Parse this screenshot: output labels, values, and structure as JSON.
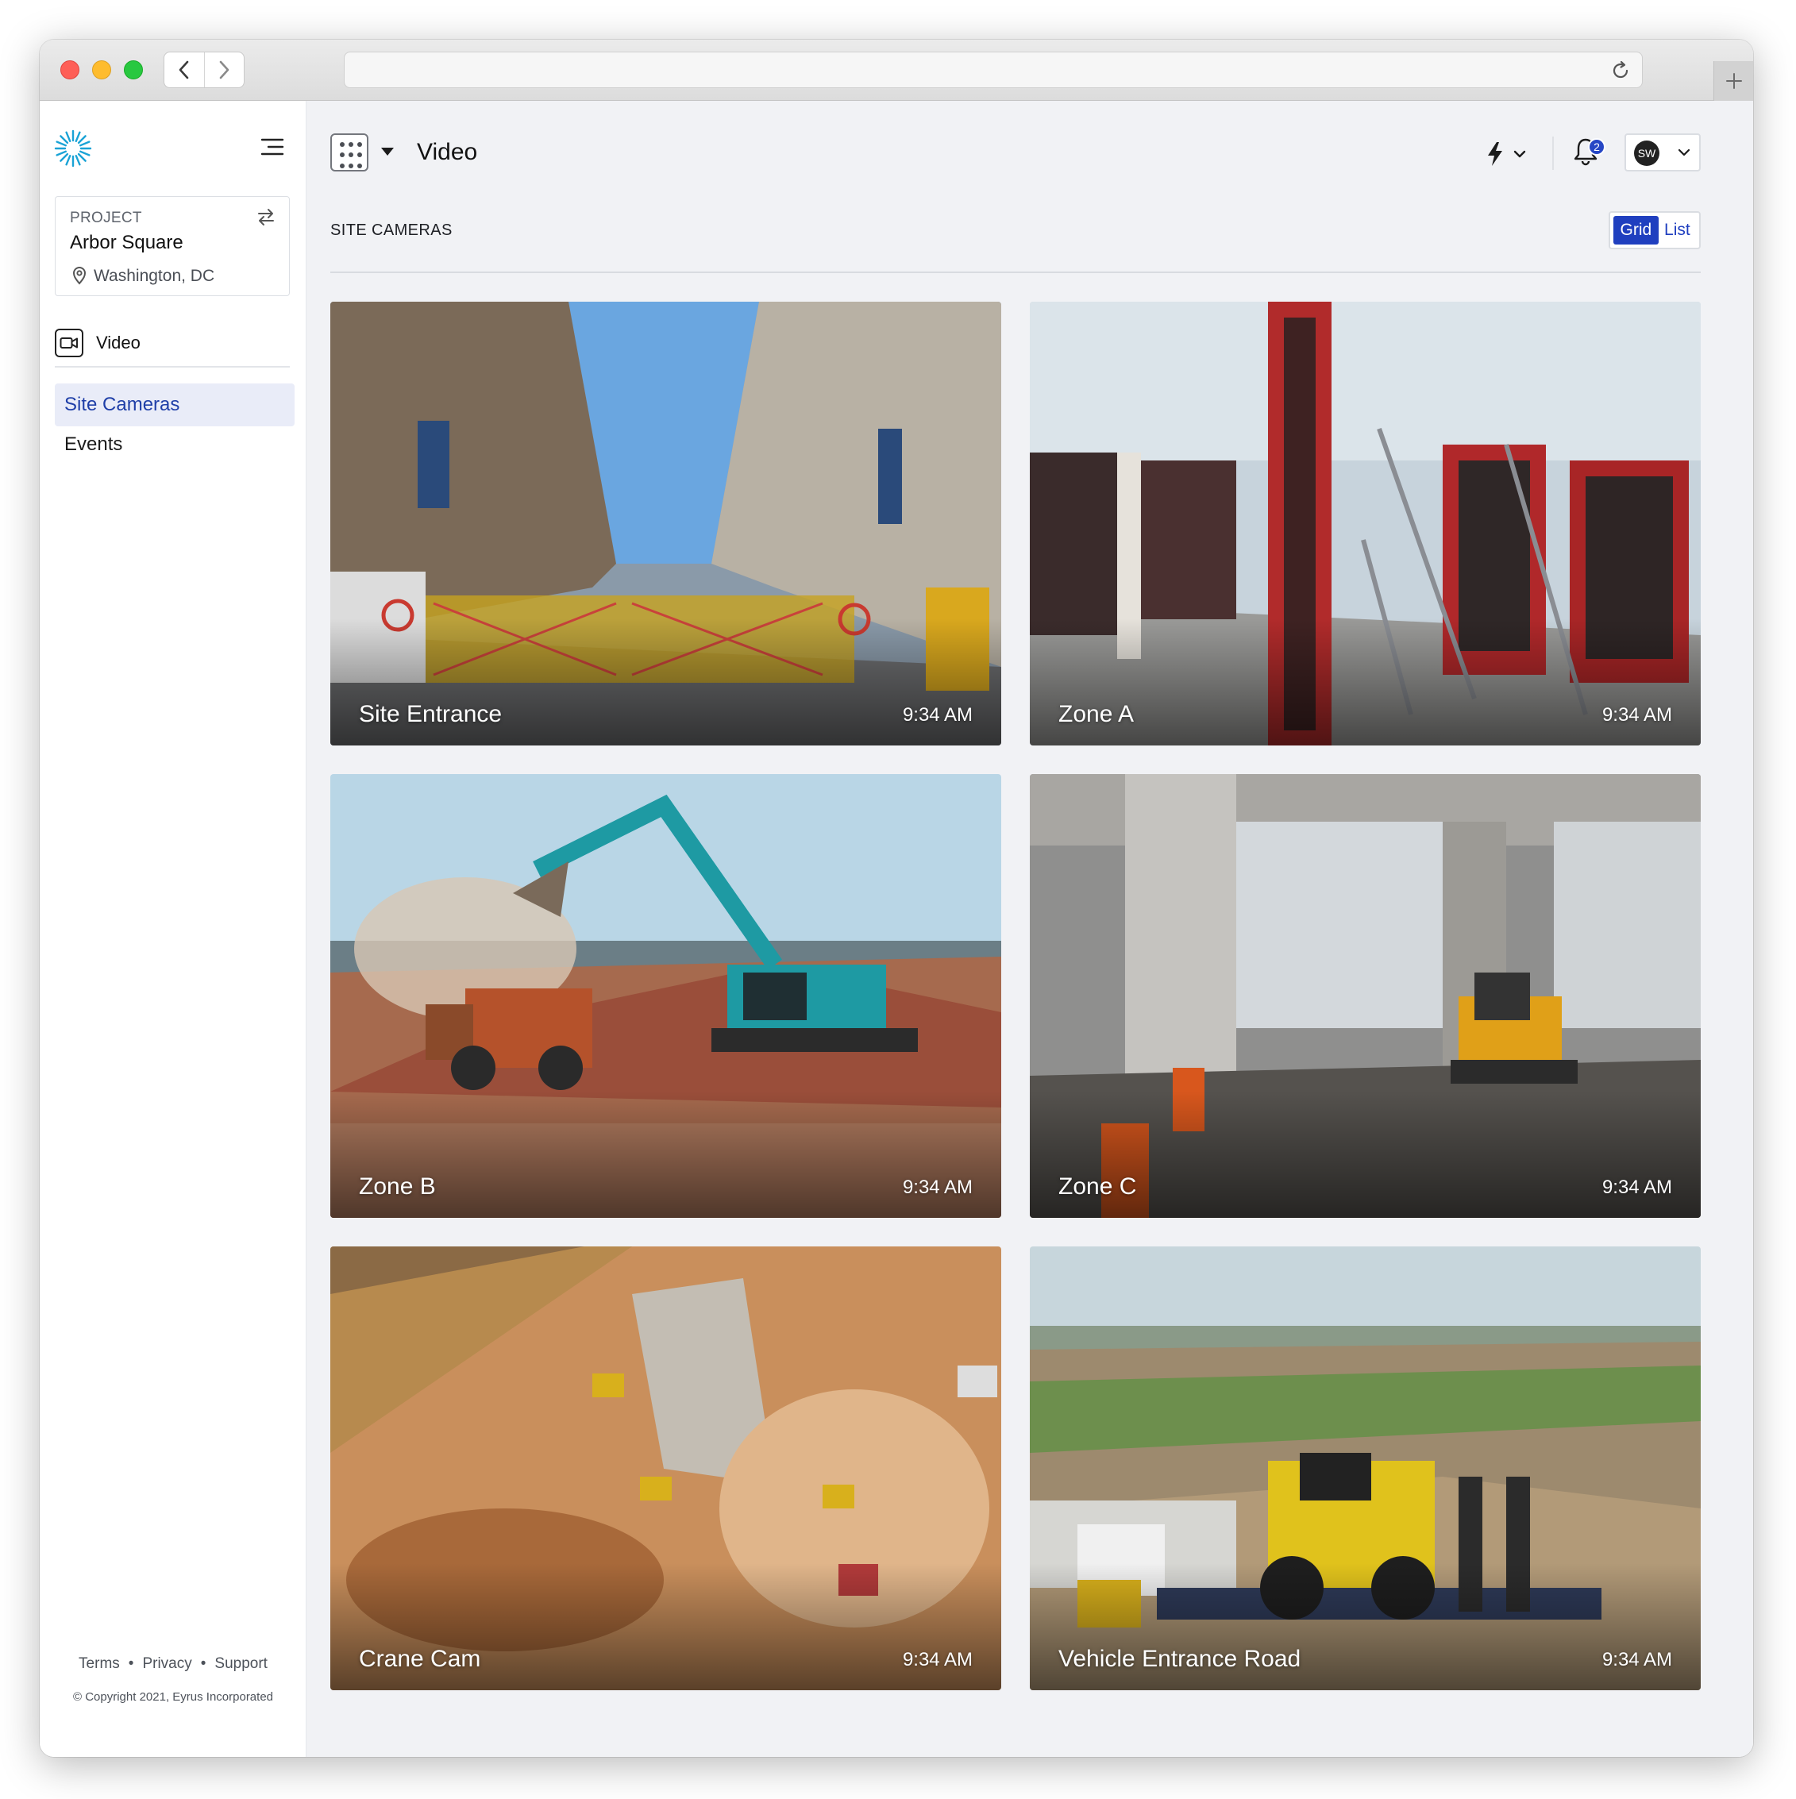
{
  "browser": {
    "address": "",
    "icons": [
      "back-icon",
      "forward-icon",
      "reload-icon",
      "new-tab-icon"
    ]
  },
  "sidebar": {
    "logo": "eyrus-logo",
    "project": {
      "label": "PROJECT",
      "name": "Arbor Square",
      "location": "Washington, DC"
    },
    "section": "Video",
    "items": [
      {
        "label": "Site Cameras",
        "active": true
      },
      {
        "label": "Events",
        "active": false
      }
    ],
    "footer": {
      "links": [
        "Terms",
        "Privacy",
        "Support"
      ],
      "copyright": "© Copyright 2021, Eyrus Incorporated"
    }
  },
  "header": {
    "title": "Video",
    "notifications": "2",
    "user_initials": "SW"
  },
  "content": {
    "section_title": "SITE CAMERAS",
    "view_toggle": {
      "grid": "Grid",
      "list": "List",
      "selected": "Grid"
    },
    "cameras": [
      {
        "name": "Site Entrance",
        "time": "9:34 AM"
      },
      {
        "name": "Zone A",
        "time": "9:34 AM"
      },
      {
        "name": "Zone B",
        "time": "9:34 AM"
      },
      {
        "name": "Zone C",
        "time": "9:34 AM"
      },
      {
        "name": "Crane Cam",
        "time": "9:34 AM"
      },
      {
        "name": "Vehicle Entrance Road",
        "time": "9:34 AM"
      }
    ]
  },
  "colors": {
    "accent": "#1f3fbf",
    "active_nav_bg": "#e9ecf8",
    "main_bg": "#f1f2f5"
  }
}
